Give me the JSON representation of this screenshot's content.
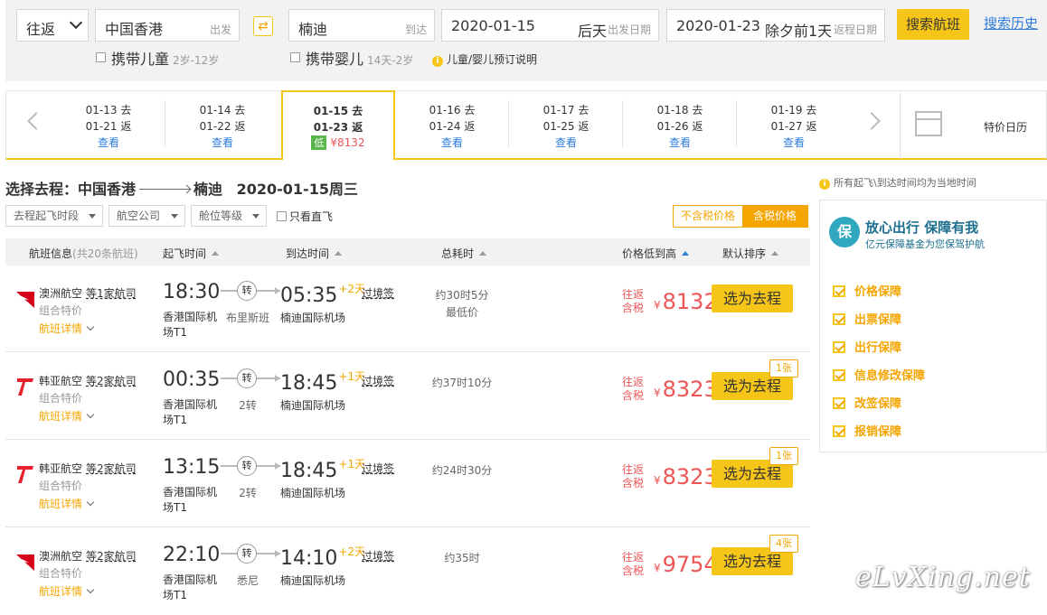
{
  "search": {
    "trip_type": "往返",
    "from_city": "中国香港",
    "from_hint": "出发",
    "swap_icon": "⇄",
    "to_city": "楠迪",
    "to_hint": "到达",
    "depart_date": "2020-01-15",
    "depart_day": "后天",
    "depart_hint": "出发日期",
    "return_date": "2020-01-23",
    "return_day": "除夕前1天",
    "return_hint": "返程日期",
    "search_button": "搜索航班",
    "history_link": "搜索历史",
    "with_child": "携带儿童",
    "child_age": "2岁-12岁",
    "with_infant": "携带婴儿",
    "infant_age": "14天-2岁",
    "info_icon": "i",
    "booking_note": "儿童/婴儿预订说明"
  },
  "date_strip": {
    "view_label": "查看",
    "dates": [
      {
        "go": "01-13 去",
        "ret": "01-21 返"
      },
      {
        "go": "01-14 去",
        "ret": "01-22 返"
      },
      {
        "go": "01-15 去",
        "ret": "01-23 返",
        "tag": "低",
        "price": "¥8132"
      },
      {
        "go": "01-16 去",
        "ret": "01-24 返"
      },
      {
        "go": "01-17 去",
        "ret": "01-25 返"
      },
      {
        "go": "01-18 去",
        "ret": "01-26 返"
      },
      {
        "go": "01-19 去",
        "ret": "01-27 返"
      }
    ],
    "calendar_label": "特价日历"
  },
  "route": {
    "prefix": "选择去程：中国香港",
    "dest": "楠迪",
    "date": "2020-01-15周三"
  },
  "filters": {
    "dep_time": "去程起飞时段",
    "airline": "航空公司",
    "cabin": "舱位等级",
    "direct_only": "只看直飞",
    "tax_off": "不含税价格",
    "tax_on": "含税价格"
  },
  "table_header": {
    "flight_info": "航班信息",
    "count": "(共20条航班)",
    "dep": "起飞时间",
    "arr": "到达时间",
    "duration": "总耗时",
    "price": "价格低到高",
    "default_sort": "默认排序"
  },
  "flights": [
    {
      "airline": "澳洲航空",
      "more": "等1家航司",
      "combo": "组合特价",
      "detail": "航班详情",
      "dep_time": "18:30",
      "dep_airport": "香港国际机场T1",
      "transfer": "转",
      "via": "布里斯班",
      "arr_time": "05:35",
      "plus_days": "+2天",
      "arr_airport": "楠迪国际机场",
      "visa": "过境签",
      "duration": "约30时5分",
      "note": "最低价",
      "price_label1": "往返",
      "price_label2": "含税",
      "currency": "¥",
      "price": "8132",
      "select": "选为去程",
      "seats": ""
    },
    {
      "airline": "韩亚航空",
      "more": "等2家航司",
      "combo": "组合特价",
      "detail": "航班详情",
      "dep_time": "00:35",
      "dep_airport": "香港国际机场T1",
      "transfer": "转",
      "via": "2转",
      "arr_time": "18:45",
      "plus_days": "+1天",
      "arr_airport": "楠迪国际机场",
      "visa": "过境签",
      "duration": "约37时10分",
      "note": "",
      "price_label1": "往返",
      "price_label2": "含税",
      "currency": "¥",
      "price": "8323",
      "select": "选为去程",
      "seats": "1张"
    },
    {
      "airline": "韩亚航空",
      "more": "等2家航司",
      "combo": "组合特价",
      "detail": "航班详情",
      "dep_time": "13:15",
      "dep_airport": "香港国际机场T1",
      "transfer": "转",
      "via": "2转",
      "arr_time": "18:45",
      "plus_days": "+1天",
      "arr_airport": "楠迪国际机场",
      "visa": "过境签",
      "duration": "约24时30分",
      "note": "",
      "price_label1": "往返",
      "price_label2": "含税",
      "currency": "¥",
      "price": "8323",
      "select": "选为去程",
      "seats": "1张"
    },
    {
      "airline": "澳洲航空",
      "more": "等2家航司",
      "combo": "组合特价",
      "detail": "航班详情",
      "dep_time": "22:10",
      "dep_airport": "香港国际机场T1",
      "transfer": "转",
      "via": "悉尼",
      "arr_time": "14:10",
      "plus_days": "+2天",
      "arr_airport": "楠迪国际机场",
      "visa": "过境签",
      "duration": "约35时",
      "note": "",
      "price_label1": "往返",
      "price_label2": "含税",
      "currency": "¥",
      "price": "9754",
      "select": "选为去程",
      "seats": "4张"
    }
  ],
  "sidebar": {
    "time_note": "所有起飞\\到达时间均为当地时间",
    "logo_char": "保",
    "title": "放心出行 保障有我",
    "subtitle": "亿元保障基金为您保驾护航",
    "items": [
      "价格保障",
      "出票保障",
      "出行保障",
      "信息修改保障",
      "改签保障",
      "报销保障"
    ]
  },
  "watermark": "eLvXing.net",
  "colors": {
    "accent": "#f5c518",
    "price": "#e55555",
    "link": "#2f7ddb",
    "qantas": "#d4001a",
    "asiana": "#e8212e"
  }
}
